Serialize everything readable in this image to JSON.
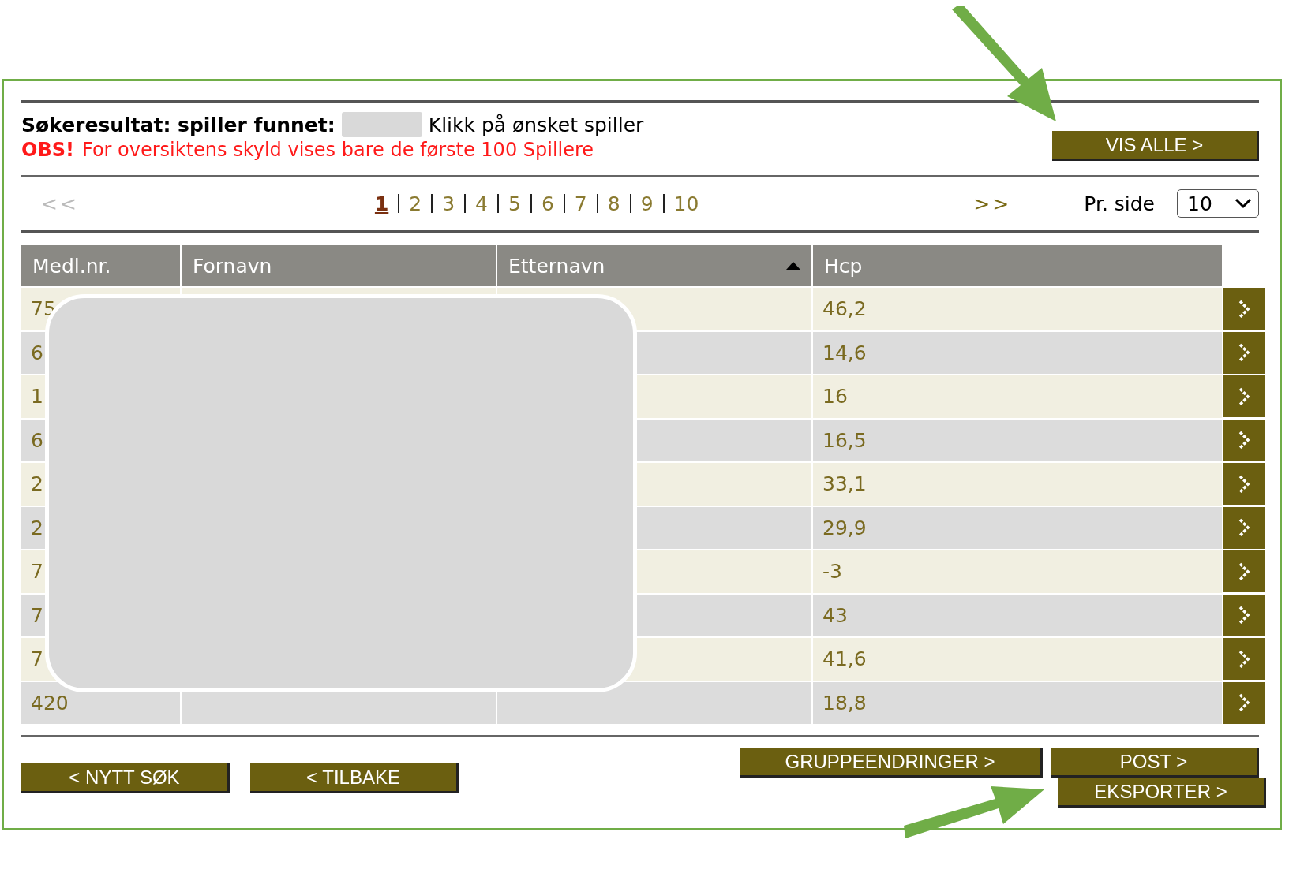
{
  "heading": {
    "label": "Søkeresultat: spiller funnet:",
    "hint": "Klikk på ønsket spiller"
  },
  "notice": {
    "flag": "OBS!",
    "text": "For oversiktens skyld vises bare de første 100 Spillere"
  },
  "show_all_button": "VIS ALLE >",
  "pagination": {
    "previous": {
      "label": "<<",
      "disabled": true
    },
    "next": {
      "label": ">>",
      "disabled": false
    },
    "pages": [
      {
        "label": "1",
        "selected": true
      },
      {
        "label": "2",
        "selected": false
      },
      {
        "label": "3",
        "selected": false
      },
      {
        "label": "4",
        "selected": false
      },
      {
        "label": "5",
        "selected": false
      },
      {
        "label": "6",
        "selected": false
      },
      {
        "label": "7",
        "selected": false
      },
      {
        "label": "8",
        "selected": false
      },
      {
        "label": "9",
        "selected": false
      },
      {
        "label": "10",
        "selected": false
      }
    ],
    "per_page_label": "Pr. side",
    "per_page_value": "10"
  },
  "table": {
    "columns": [
      {
        "label": "Medl.nr.",
        "sorted": false
      },
      {
        "label": "Fornavn",
        "sorted": false
      },
      {
        "label": "Etternavn",
        "sorted": true
      },
      {
        "label": "Hcp",
        "sorted": false
      }
    ],
    "rows": [
      {
        "medlnr": "75",
        "hcp": "46,2"
      },
      {
        "medlnr": "6",
        "hcp": "14,6"
      },
      {
        "medlnr": "1",
        "hcp": "16"
      },
      {
        "medlnr": "6",
        "hcp": "16,5"
      },
      {
        "medlnr": "2",
        "hcp": "33,1"
      },
      {
        "medlnr": "2",
        "hcp": "29,9"
      },
      {
        "medlnr": "7",
        "hcp": "-3"
      },
      {
        "medlnr": "7",
        "hcp": "43"
      },
      {
        "medlnr": "7",
        "hcp": "41,6"
      },
      {
        "medlnr": "420",
        "hcp": "18,8"
      }
    ]
  },
  "bottom_buttons": {
    "new_search": "< NYTT SØK",
    "back": "< TILBAKE",
    "group_changes": "GRUPPEENDRINGER >",
    "post": "POST >",
    "export": "EKSPORTER >"
  }
}
